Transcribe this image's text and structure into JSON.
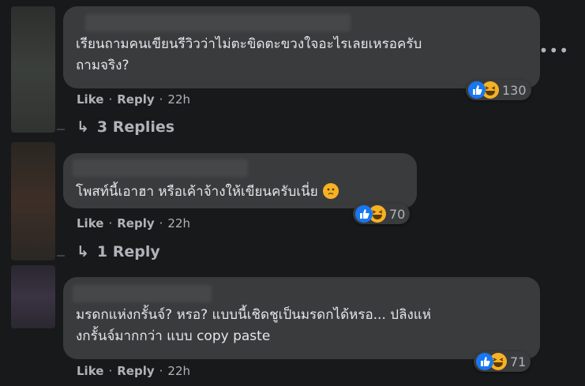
{
  "comments": [
    {
      "text_lines": [
        "เรียนถามคนเขียนรีวิวว่าไม่ตะขิดตะขวงใจอะไรเลยเหรอครับ",
        "ถามจริง?"
      ],
      "actions": {
        "like": "Like",
        "reply": "Reply",
        "time": "22h"
      },
      "reaction_count": "130",
      "reply_link": "3 Replies"
    },
    {
      "text_lines": [
        "โพสท์นี้เอาฮา หรือเค้าจ้างให้เขียนครับเนี่ย"
      ],
      "actions": {
        "like": "Like",
        "reply": "Reply",
        "time": "22h"
      },
      "reaction_count": "70",
      "reply_link": "1 Reply"
    },
    {
      "text_lines": [
        "มรดกแห่งกรั้นจ์? หรอ? แบบนี้เชิดชูเป็นมรดกได้หรอ... ปลิงแห่",
        "งกรั้นจ์มากกว่า แบบ copy paste"
      ],
      "actions": {
        "like": "Like",
        "reply": "Reply",
        "time": "22h"
      },
      "reaction_count": "71"
    }
  ],
  "separator": "·",
  "more_menu": "•••",
  "reply_arrow": "↳",
  "colors": {
    "like": "#1877f2",
    "haha": "#f7b125",
    "bubble": "#3a3b3c",
    "bg": "#18191a"
  }
}
